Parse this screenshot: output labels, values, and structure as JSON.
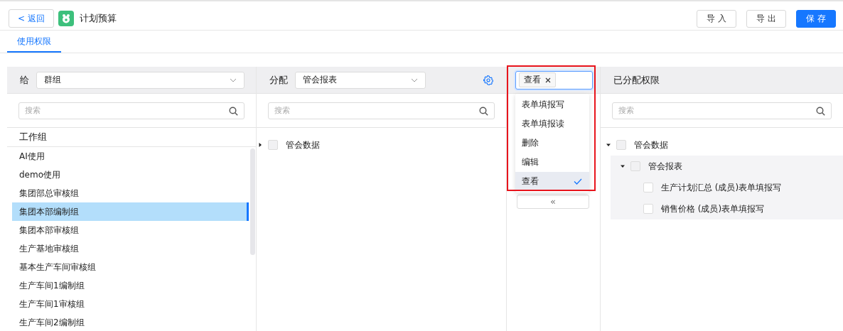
{
  "header": {
    "back_label": "< 返回",
    "title": "计划预算",
    "buttons": [
      {
        "label": "导 入",
        "primary": false
      },
      {
        "label": "导 出",
        "primary": false
      },
      {
        "label": "保 存",
        "primary": true
      }
    ]
  },
  "tabs": [
    {
      "label": "使用权限",
      "selected": true
    }
  ],
  "grant_panel": {
    "label": "给",
    "select_value": "群组",
    "search_placeholder": "搜索",
    "group_heading": "工作组",
    "items": [
      {
        "label": "AI使用",
        "selected": false
      },
      {
        "label": "demo使用",
        "selected": false
      },
      {
        "label": "集团部总审核组",
        "selected": false
      },
      {
        "label": "集团本部编制组",
        "selected": true
      },
      {
        "label": "集团本部审核组",
        "selected": false
      },
      {
        "label": "生产基地审核组",
        "selected": false
      },
      {
        "label": "基本生产车间审核组",
        "selected": false
      },
      {
        "label": "生产车间1编制组",
        "selected": false
      },
      {
        "label": "生产车间1审核组",
        "selected": false
      },
      {
        "label": "生产车间2编制组",
        "selected": false
      }
    ]
  },
  "assign_panel": {
    "label": "分配",
    "select_value": "管会报表",
    "search_placeholder": "搜索",
    "tree": [
      {
        "label": "管会数据",
        "checked": false,
        "expanded": false
      }
    ]
  },
  "permission_select": {
    "tags": [
      "查看"
    ],
    "options": [
      {
        "label": "表单填报写",
        "selected": false
      },
      {
        "label": "表单填报读",
        "selected": false
      },
      {
        "label": "删除",
        "selected": false
      },
      {
        "label": "编辑",
        "selected": false
      },
      {
        "label": "查看",
        "selected": true
      }
    ],
    "move_left_label": "«"
  },
  "assigned_panel": {
    "title": "已分配权限",
    "search_placeholder": "搜索",
    "tree": [
      {
        "label": "管会数据",
        "checked": false,
        "expanded": true,
        "children": [
          {
            "label": "管会报表",
            "checked": false,
            "expanded": true,
            "children": [
              {
                "label": "生产计划汇总 (成员)表单填报写",
                "checked": false
              },
              {
                "label": "销售价格 (成员)表单填报写",
                "checked": false
              }
            ]
          }
        ]
      }
    ]
  }
}
